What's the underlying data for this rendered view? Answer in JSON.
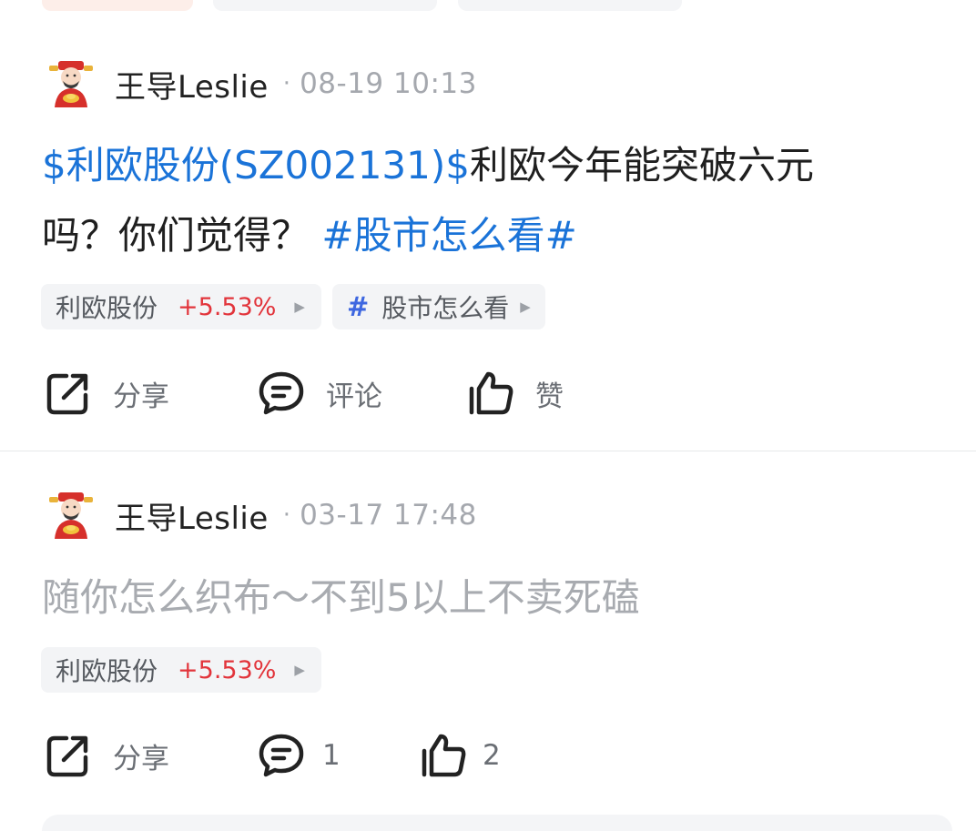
{
  "posts": [
    {
      "author": "王导Leslie",
      "separator": "·",
      "timestamp": "08-19 10:13",
      "content": {
        "stock_link": "$利欧股份(SZ002131)$",
        "text_line1": "利欧今年能突破六元",
        "text_line2": "吗？你们觉得？",
        "topic_link": "#股市怎么看#"
      },
      "chips": [
        {
          "name": "利欧股份",
          "change": "+5.53%",
          "arrow": "▶"
        },
        {
          "hash": "#",
          "name": "股市怎么看",
          "arrow": "▶"
        }
      ],
      "actions": {
        "share": "分享",
        "comment": "评论",
        "like": "赞"
      }
    },
    {
      "author": "王导Leslie",
      "separator": "·",
      "timestamp": "03-17 17:48",
      "content": {
        "text": "随你怎么织布～不到5以上不卖死磕"
      },
      "chips": [
        {
          "name": "利欧股份",
          "change": "+5.53%",
          "arrow": "▶"
        }
      ],
      "actions": {
        "share": "分享",
        "comment": "1",
        "like": "2"
      }
    }
  ],
  "colors": {
    "link": "#1a73d8",
    "gain": "#e2343b",
    "topic_hash": "#3e67e0",
    "muted_text": "#a8abb0"
  },
  "icons": {
    "avatar": "caishen-avatar",
    "share": "share-icon",
    "comment": "comment-icon",
    "like": "thumbs-up-icon"
  }
}
